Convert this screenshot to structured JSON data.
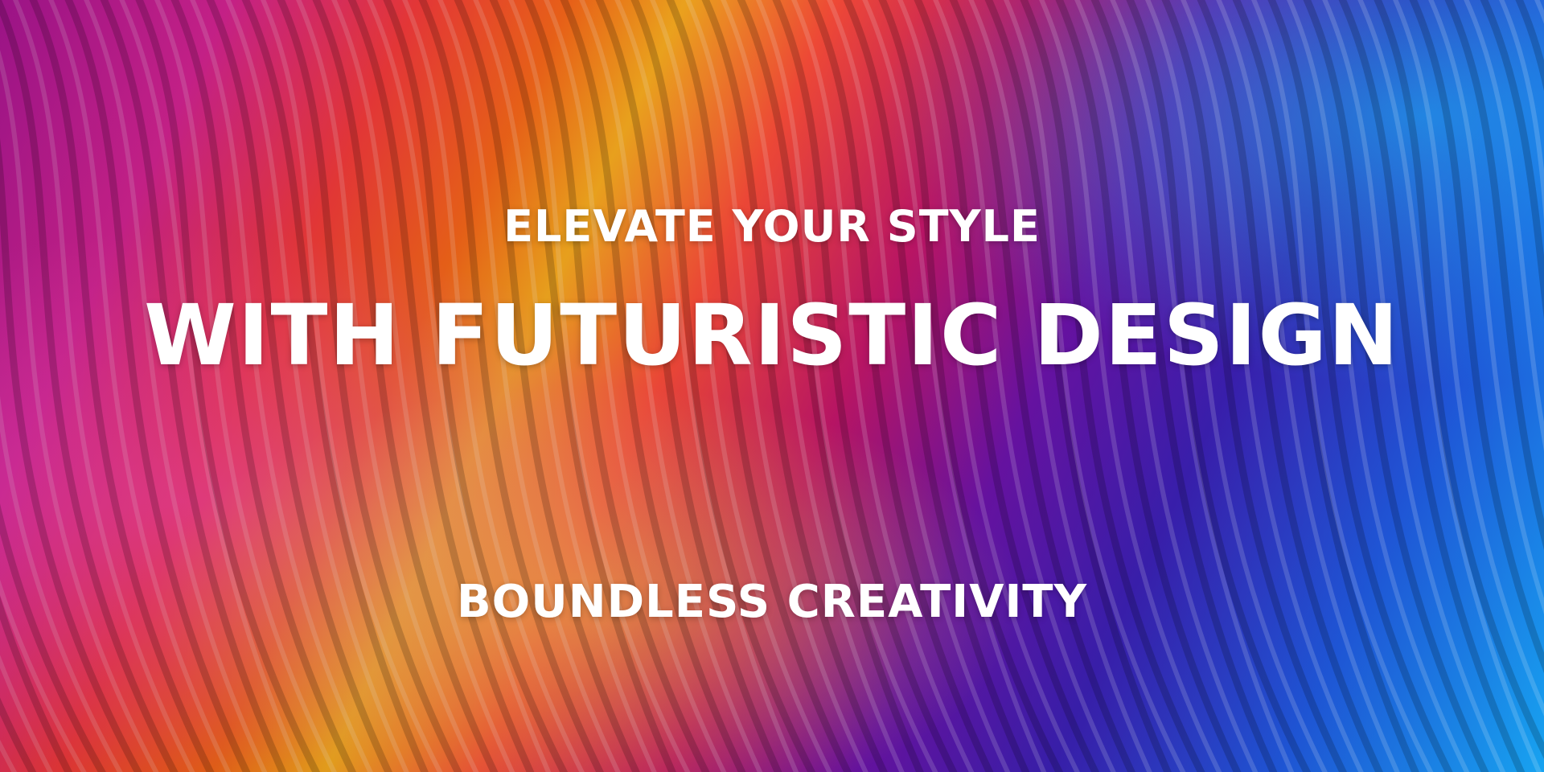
{
  "banner": {
    "line1": "ELEVATE YOUR STYLE",
    "line2": "WITH FUTURISTIC DESIGN",
    "line3": "BOUNDLESS CREATIVITY"
  },
  "colors": {
    "magenta": "#d21fa0",
    "orange": "#ff6a1a",
    "yellow": "#ffb020",
    "purple": "#5a15b0",
    "blue": "#1f56d8",
    "cyan": "#17a3f0",
    "text": "#ffffff"
  }
}
